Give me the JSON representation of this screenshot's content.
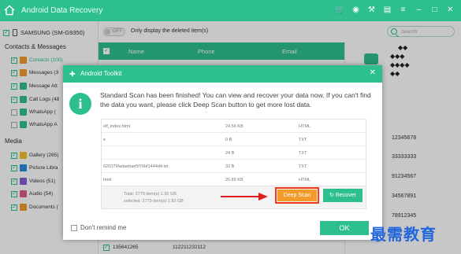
{
  "app": {
    "title": "Android Data Recovery"
  },
  "device": {
    "name": "SAMSUNG (SM-G9350)"
  },
  "sidebar": {
    "contacts_header": "Contacts & Messages",
    "media_header": "Media",
    "items": [
      {
        "label": "Contacts (100)",
        "color": "#f39a2c",
        "icon": "contacts-icon"
      },
      {
        "label": "Messages (3",
        "color": "#f39a2c",
        "icon": "messages-icon"
      },
      {
        "label": "Message Att",
        "color": "#2ebf8f",
        "icon": "attachment-icon"
      },
      {
        "label": "Call Logs (48",
        "color": "#2ebf8f",
        "icon": "call-logs-icon"
      },
      {
        "label": "WhatsApp (",
        "color": "#2ebf8f",
        "icon": "whatsapp-icon"
      },
      {
        "label": "WhatsApp A",
        "color": "#2ebf8f",
        "icon": "whatsapp-attachment-icon"
      }
    ],
    "media_items": [
      {
        "label": "Gallery (265)",
        "color": "#f3c12c",
        "icon": "gallery-icon"
      },
      {
        "label": "Picture Libra",
        "color": "#2b8de0",
        "icon": "picture-library-icon"
      },
      {
        "label": "Videos (51)",
        "color": "#8a5cd8",
        "icon": "videos-icon"
      },
      {
        "label": "Audio (54)",
        "color": "#e05a8a",
        "icon": "audio-icon"
      },
      {
        "label": "Documents (",
        "color": "#f39a2c",
        "icon": "documents-icon"
      }
    ]
  },
  "toolbar": {
    "toggle_label": "OFF",
    "only_deleted_label": "Only display the deleted item(s)",
    "search_placeholder": "Search"
  },
  "table": {
    "headers": [
      "Name",
      "Phone",
      "Email"
    ],
    "bottom_row": {
      "name": "135641265",
      "phone": "112211232112"
    }
  },
  "right_panel": {
    "message_lines": [
      "◆◆",
      "◆◆◆",
      "◆◆◆◆",
      "◆◆"
    ],
    "numbers": [
      "12345678",
      "33333333",
      "91234567",
      "34567891",
      "78912345"
    ]
  },
  "dialog": {
    "title": "Android Toolkit",
    "message": "Standard Scan has been finished! You can view and recover your data now. If you can't find the data you want, please click Deep Scan button to get more lost data.",
    "files": [
      {
        "name": "elf_index.html",
        "size": "24.56 KB",
        "type": "HTML"
      },
      {
        "name": "e",
        "size": "0 B",
        "type": "TXT"
      },
      {
        "name": "",
        "size": "24 B",
        "type": "TXT"
      },
      {
        "name": "620379fadaebae5f76bf1444d4.txt",
        "size": "32 B",
        "type": "TXT"
      },
      {
        "name": "html",
        "size": "26.85 KB",
        "type": "HTML"
      }
    ],
    "total_text": "Total: 2779 item(s) 1.92 GB",
    "selected_text": "selected: 2779 item(s) 1.92 GB",
    "deep_scan_label": "Deep Scan",
    "recover_label": "Recover",
    "dont_remind_label": "Don't remind me",
    "ok_label": "OK"
  },
  "watermark": {
    "text": "最需教育"
  }
}
